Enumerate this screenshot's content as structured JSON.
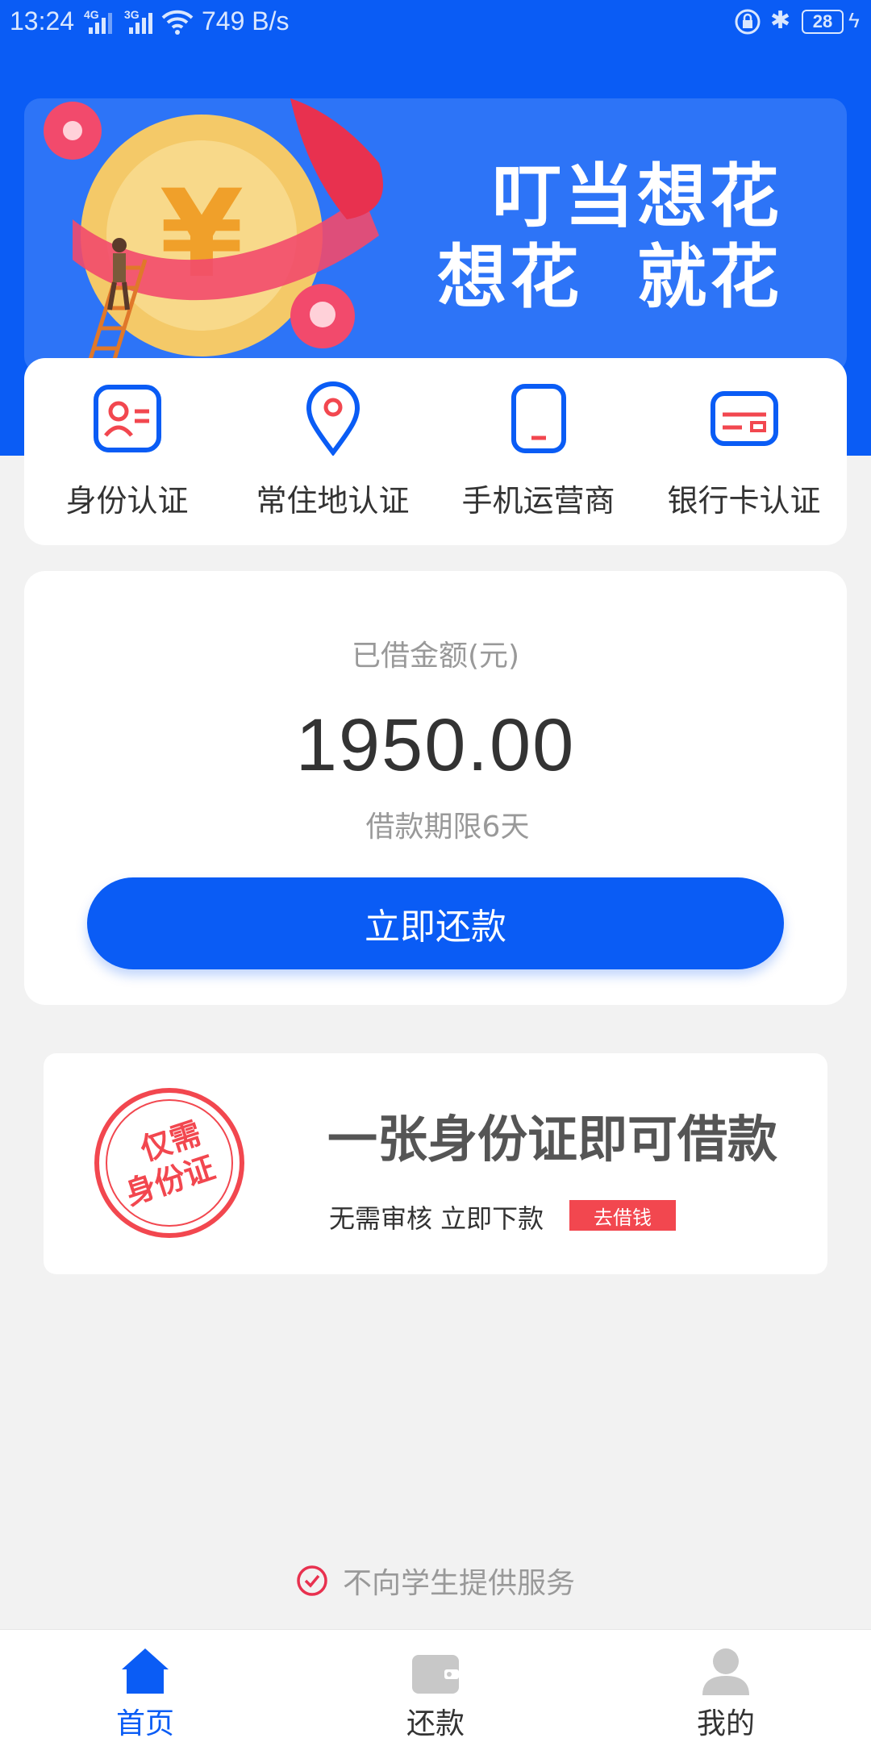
{
  "status_bar": {
    "time": "13:24",
    "network_1": "4G",
    "network_2": "3G",
    "speed": "749 B/s",
    "battery": "28"
  },
  "banner": {
    "line1": "叮当想花",
    "line2": "想花  就花"
  },
  "verification": [
    {
      "label": "身份认证",
      "icon": "id-card-icon"
    },
    {
      "label": "常住地认证",
      "icon": "location-pin-icon"
    },
    {
      "label": "手机运营商",
      "icon": "phone-icon"
    },
    {
      "label": "银行卡认证",
      "icon": "bank-card-icon"
    }
  ],
  "loan": {
    "caption": "已借金额(元)",
    "amount": "1950.00",
    "term": "借款期限6天",
    "button": "立即还款"
  },
  "promo": {
    "stamp_text": "仅需身份证",
    "title": "一张身份证即可借款",
    "subtitle": "无需审核 立即下款",
    "badge": "去借钱"
  },
  "notice": "不向学生提供服务",
  "bottom_nav": [
    {
      "label": "首页",
      "icon": "home-icon",
      "active": true
    },
    {
      "label": "还款",
      "icon": "wallet-icon",
      "active": false
    },
    {
      "label": "我的",
      "icon": "user-icon",
      "active": false
    }
  ],
  "colors": {
    "primary": "#0a5cf5",
    "accent_red": "#f2474f",
    "background": "#f2f2f2"
  }
}
